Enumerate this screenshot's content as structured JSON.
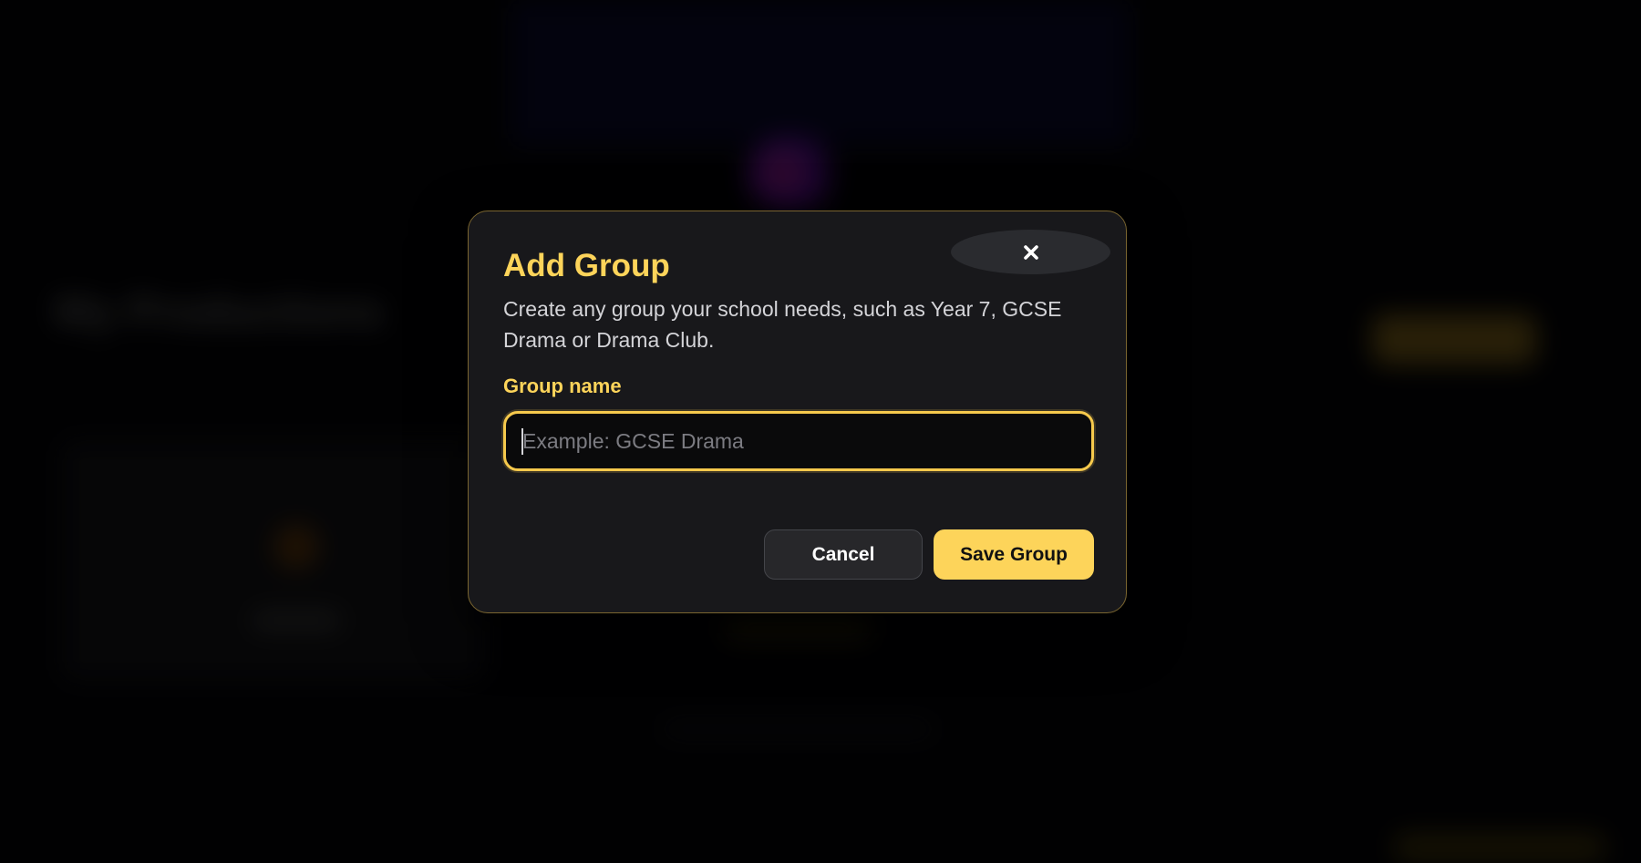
{
  "background": {
    "page_title": "My Productions"
  },
  "modal": {
    "title": "Add Group",
    "description": "Create any group your school needs, such as Year 7, GCSE Drama or Drama Club.",
    "close_icon": "close-icon",
    "field": {
      "label": "Group name",
      "value": "",
      "placeholder": "Example: GCSE Drama"
    },
    "buttons": {
      "cancel_label": "Cancel",
      "save_label": "Save Group"
    }
  },
  "colors": {
    "accent": "#fdd45a",
    "modal_bg": "#18181b",
    "modal_border": "#7a6530",
    "input_border": "#f6c94c",
    "text_muted": "#d4d4d8"
  }
}
